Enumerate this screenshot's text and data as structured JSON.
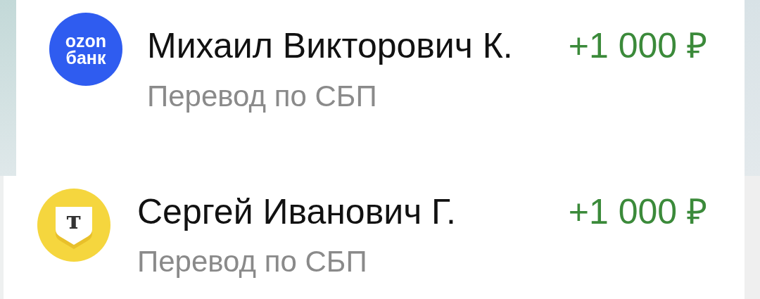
{
  "transactions": [
    {
      "bank": {
        "kind": "ozon",
        "logo_text": [
          "ozon",
          "банк"
        ]
      },
      "name": "Михаил Викторович К.",
      "amount": "+1 000 ₽",
      "description": "Перевод по СБП"
    },
    {
      "bank": {
        "kind": "tbank",
        "logo_text": [
          "т"
        ]
      },
      "name": "Сергей Иванович Г.",
      "amount": "+1 000 ₽",
      "description": "Перевод по СБП"
    }
  ]
}
